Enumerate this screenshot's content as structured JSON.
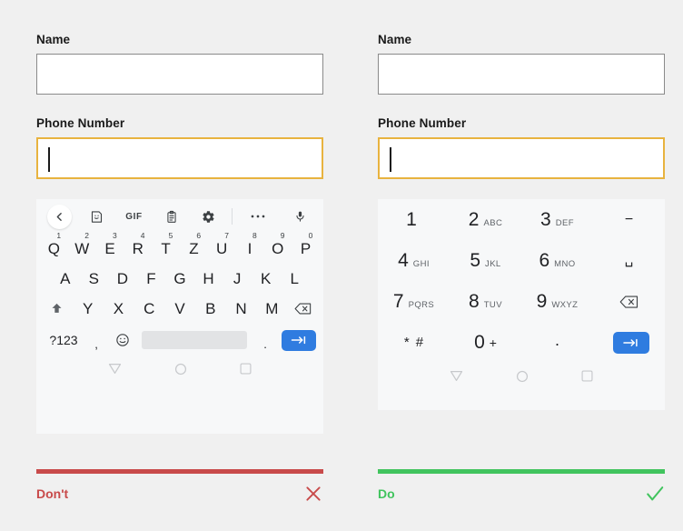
{
  "panels": [
    {
      "id": "dont",
      "form": {
        "name_label": "Name",
        "name_value": "",
        "phone_label": "Phone Number",
        "phone_value": "",
        "phone_focused": true
      },
      "keyboard": {
        "type": "qwertz-alphabetic",
        "toolbar": [
          {
            "name": "back-icon",
            "label": "back"
          },
          {
            "name": "sticker-icon",
            "label": "sticker"
          },
          {
            "name": "gif-icon",
            "label": "GIF"
          },
          {
            "name": "clipboard-icon",
            "label": "clipboard"
          },
          {
            "name": "gear-icon",
            "label": "settings"
          },
          {
            "name": "divider",
            "label": ""
          },
          {
            "name": "overflow-icon",
            "label": "more"
          },
          {
            "name": "microphone-icon",
            "label": "voice input"
          }
        ],
        "row1": [
          {
            "letter": "Q",
            "num": "1"
          },
          {
            "letter": "W",
            "num": "2"
          },
          {
            "letter": "E",
            "num": "3"
          },
          {
            "letter": "R",
            "num": "4"
          },
          {
            "letter": "T",
            "num": "5"
          },
          {
            "letter": "Z",
            "num": "6"
          },
          {
            "letter": "U",
            "num": "7"
          },
          {
            "letter": "I",
            "num": "8"
          },
          {
            "letter": "O",
            "num": "9"
          },
          {
            "letter": "P",
            "num": "0"
          }
        ],
        "row2": [
          "A",
          "S",
          "D",
          "F",
          "G",
          "H",
          "J",
          "K",
          "L"
        ],
        "row3": [
          "Y",
          "X",
          "C",
          "V",
          "B",
          "N",
          "M"
        ],
        "shift_label": "shift",
        "backspace_label": "backspace",
        "bottom": {
          "symbols_label": "?123",
          "comma_label": ",",
          "emoji_label": "emoji",
          "space_label": "",
          "period_label": ".",
          "enter_label": "next"
        }
      },
      "navbar": [
        "back",
        "home",
        "recents"
      ],
      "footer": {
        "label": "Don't",
        "mark": "cross",
        "color": "#c84a4a"
      }
    },
    {
      "id": "do",
      "form": {
        "name_label": "Name",
        "name_value": "",
        "phone_label": "Phone Number",
        "phone_value": "",
        "phone_focused": true
      },
      "keypad": {
        "type": "numeric-phone",
        "rows": [
          [
            {
              "num": "1",
              "sub": ""
            },
            {
              "num": "2",
              "sub": "ABC"
            },
            {
              "num": "3",
              "sub": "DEF"
            },
            {
              "num": "−",
              "sub": "",
              "plain": true
            }
          ],
          [
            {
              "num": "4",
              "sub": "GHI"
            },
            {
              "num": "5",
              "sub": "JKL"
            },
            {
              "num": "6",
              "sub": "MNO"
            },
            {
              "num": "␣",
              "sub": "",
              "plain": true
            }
          ],
          [
            {
              "num": "7",
              "sub": "PQRS"
            },
            {
              "num": "8",
              "sub": "TUV"
            },
            {
              "num": "9",
              "sub": "WXYZ"
            },
            {
              "num": "",
              "sub": "",
              "icon": "backspace"
            }
          ],
          [
            {
              "num": "*",
              "sub": "#",
              "star": true
            },
            {
              "num": "0",
              "sub": "+",
              "plain2": true
            },
            {
              "num": ".",
              "sub": "",
              "dot": true
            },
            {
              "num": "",
              "sub": "",
              "icon": "enter"
            }
          ]
        ]
      },
      "navbar": [
        "back",
        "home",
        "recents"
      ],
      "footer": {
        "label": "Do",
        "mark": "check",
        "color": "#41c45e"
      }
    }
  ],
  "theme": {
    "page_bg": "#f0f0f0",
    "keyboard_bg": "#f7f8f9",
    "focus_border": "#e8b33f",
    "accent_blue": "#2f7ce0",
    "dont_color": "#c84a4a",
    "do_color": "#41c45e"
  }
}
